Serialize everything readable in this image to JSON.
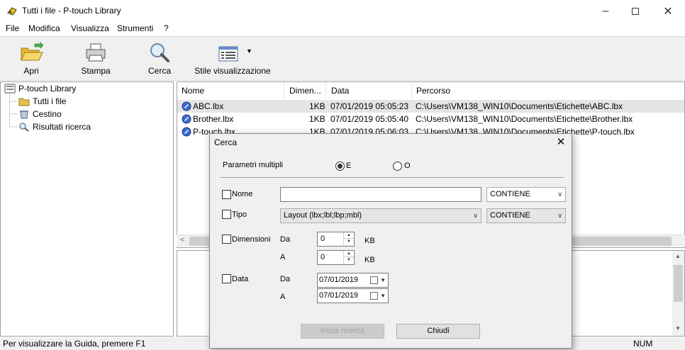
{
  "window": {
    "title": "Tutti i file - P-touch Library",
    "minimize_icon": "minimize-icon",
    "maximize_icon": "maximize-icon",
    "close_icon": "close-icon"
  },
  "menu": [
    "File",
    "Modifica",
    "Visualizza",
    "Strumenti",
    "?"
  ],
  "toolbar": {
    "open_label": "Apri",
    "print_label": "Stampa",
    "search_label": "Cerca",
    "view_style_label": "Stile visualizzazione"
  },
  "tree": {
    "root": "P-touch Library",
    "items": [
      "Tutti i file",
      "Cestino",
      "Risultati ricerca"
    ]
  },
  "list": {
    "columns": [
      "Nome",
      "Dimen...",
      "Data",
      "Percorso"
    ],
    "rows": [
      {
        "name": "ABC.lbx",
        "size": "1KB",
        "date": "07/01/2019 05:05:23",
        "path": "C:\\Users\\VM138_WIN10\\Documents\\Etichette\\ABC.lbx"
      },
      {
        "name": "Brother.lbx",
        "size": "1KB",
        "date": "07/01/2019 05:05:40",
        "path": "C:\\Users\\VM138_WIN10\\Documents\\Etichette\\Brother.lbx"
      },
      {
        "name": "P-touch.lbx",
        "size": "1KB",
        "date": "07/01/2019 05:06:03",
        "path": "C:\\Users\\VM138_WIN10\\Documents\\Etichette\\P-touch.lbx"
      }
    ]
  },
  "status": {
    "help_text": "Per visualizzare la Guida, premere F1",
    "num": "NUM"
  },
  "dialog": {
    "title": "Cerca",
    "multi_params_label": "Parametri multipli",
    "radio_and": "E",
    "radio_or": "O",
    "name_label": "Nome",
    "name_value": "",
    "name_condition": "CONTIENE",
    "type_label": "Tipo",
    "type_value": "Layout (lbx;lbl;lbp;mbl)",
    "type_condition": "CONTIENE",
    "size_label": "Dimensioni",
    "size_from_label": "Da",
    "size_from_value": "0",
    "size_to_label": "A",
    "size_to_value": "0",
    "size_unit": "KB",
    "date_label": "Data",
    "date_from_label": "Da",
    "date_from_value": "07/01/2019",
    "date_to_label": "A",
    "date_to_value": "07/01/2019",
    "start_button": "Inizia ricerca",
    "close_button": "Chiudi"
  }
}
